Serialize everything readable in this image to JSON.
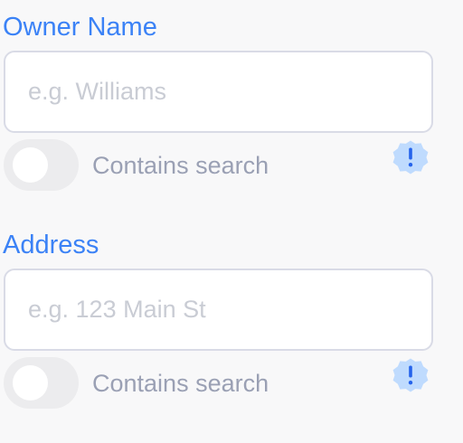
{
  "fields": [
    {
      "label": "Owner Name",
      "placeholder": "e.g. Williams",
      "value": "",
      "toggle": {
        "label": "Contains search",
        "on": false
      },
      "info_icon": "exclamation-badge-icon"
    },
    {
      "label": "Address",
      "placeholder": "e.g. 123 Main St",
      "value": "",
      "toggle": {
        "label": "Contains search",
        "on": false
      },
      "info_icon": "exclamation-badge-icon"
    }
  ],
  "colors": {
    "label": "#3b82f6",
    "icon_fill": "#bfdbfe",
    "icon_mark": "#2563eb",
    "toggle_track": "#ececee",
    "muted_text": "#9aa0b4"
  }
}
